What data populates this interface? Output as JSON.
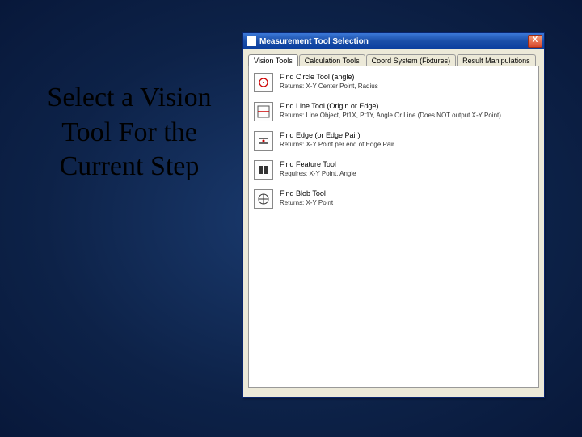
{
  "slide": {
    "caption": "Select a Vision Tool For the Current Step"
  },
  "window": {
    "title": "Measurement Tool Selection",
    "close_label": "X"
  },
  "tabs": [
    {
      "label": "Vision Tools"
    },
    {
      "label": "Calculation Tools"
    },
    {
      "label": "Coord System (Fixtures)"
    },
    {
      "label": "Result Manipulations"
    }
  ],
  "tools": [
    {
      "title": "Find Circle Tool (angle)",
      "desc": "Returns: X-Y Center Point, Radius"
    },
    {
      "title": "Find Line Tool (Origin or Edge)",
      "desc": "Returns: Line Object, Pt1X, Pt1Y, Angle Or Line (Does NOT output X-Y Point)"
    },
    {
      "title": "Find Edge (or Edge Pair)",
      "desc": "Returns: X-Y Point per end of Edge Pair"
    },
    {
      "title": "Find Feature Tool",
      "desc": "Requires: X-Y Point, Angle"
    },
    {
      "title": "Find Blob Tool",
      "desc": "Returns: X-Y Point"
    }
  ]
}
